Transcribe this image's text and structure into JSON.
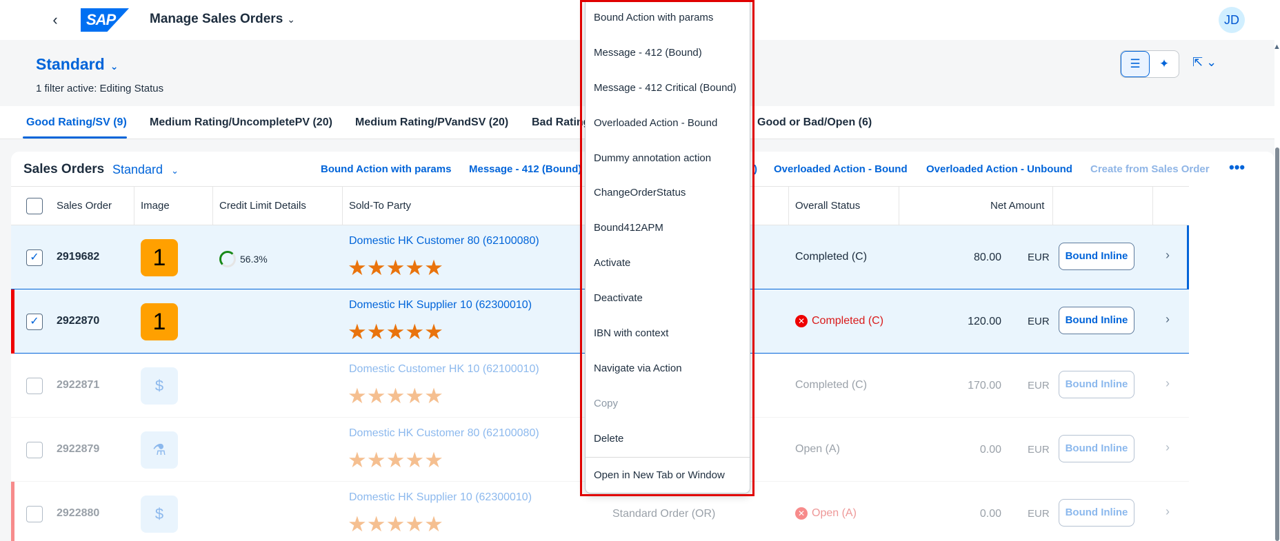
{
  "shell": {
    "app_title": "Manage Sales Orders",
    "logo_text": "SAP",
    "avatar": "JD"
  },
  "header": {
    "variant": "Standard",
    "filter_text": "1 filter active: Editing Status"
  },
  "tabs": [
    {
      "label": "Good Rating/SV (9)",
      "selected": true
    },
    {
      "label": "Medium Rating/UncompletePV (20)"
    },
    {
      "label": "Medium Rating/PVandSV (20)"
    },
    {
      "label": "Bad Rating"
    },
    {
      "label": "Good or Bad/Open (6)"
    }
  ],
  "table": {
    "title": "Sales Orders",
    "variant": "Standard",
    "toolbar_actions": [
      {
        "label": "Bound Action with params"
      },
      {
        "label": "Message - 412 (Bound)"
      },
      {
        "label": ")"
      },
      {
        "label": "Overloaded Action - Bound"
      },
      {
        "label": "Overloaded Action - Unbound"
      },
      {
        "label": "Create from Sales Order",
        "disabled": true
      }
    ],
    "columns": {
      "sales_order": "Sales Order",
      "image": "Image",
      "credit": "Credit Limit Details",
      "party": "Sold-To Party",
      "status": "Overall Status",
      "net_amount": "Net Amount"
    },
    "rows": [
      {
        "so": "2919682",
        "image_text": "1",
        "credit": "56.3%",
        "party": "Domestic HK Customer 80 (62100080)",
        "stars": "★★★★★",
        "status": "Completed (C)",
        "amount": "80.00",
        "currency": "EUR",
        "button": "Bound Inline",
        "selected": true
      },
      {
        "so": "2922870",
        "image_text": "1",
        "party": "Domestic HK Supplier 10 (62300010)",
        "stars": "★★★★★",
        "status": "Completed (C)",
        "amount": "120.00",
        "currency": "EUR",
        "button": "Bound Inline",
        "selected": true,
        "error": true
      },
      {
        "so": "2922871",
        "image_icon": "money-icon",
        "party": "Domestic Customer HK 10 (62100010)",
        "stars": "★★★★★",
        "status": "Completed (C)",
        "amount": "170.00",
        "currency": "EUR",
        "button": "Bound Inline"
      },
      {
        "so": "2922879",
        "image_icon": "flask-icon",
        "party": "Domestic HK Customer 80 (62100080)",
        "stars": "★★★★★",
        "status": "Open (A)",
        "amount": "0.00",
        "currency": "EUR",
        "button": "Bound Inline"
      },
      {
        "so": "2922880",
        "image_icon": "money-icon",
        "party": "Domestic HK Supplier 10 (62300010)",
        "stars": "★★★★★",
        "order_type": "Standard Order (OR)",
        "status": "Open (A)",
        "amount": "0.00",
        "currency": "EUR",
        "button": "Bound Inline",
        "error": true
      }
    ]
  },
  "menu": {
    "items": [
      {
        "label": "Bound Action with params"
      },
      {
        "label": "Message - 412 (Bound)"
      },
      {
        "label": "Message - 412 Critical (Bound)"
      },
      {
        "label": "Overloaded Action - Bound"
      },
      {
        "label": "Dummy annotation action"
      },
      {
        "label": "ChangeOrderStatus"
      },
      {
        "label": "Bound412APM"
      },
      {
        "label": "Activate"
      },
      {
        "label": "Deactivate"
      },
      {
        "label": "IBN with context"
      },
      {
        "label": "Navigate via Action"
      },
      {
        "label": "Copy",
        "disabled": true
      },
      {
        "label": "Delete"
      },
      {
        "label": "Open in New Tab or Window"
      }
    ]
  },
  "colors": {
    "accent": "#0064d9",
    "highlight_outline": "#e00000",
    "rating_star": "#e9730c",
    "badge": "#ffa000"
  }
}
